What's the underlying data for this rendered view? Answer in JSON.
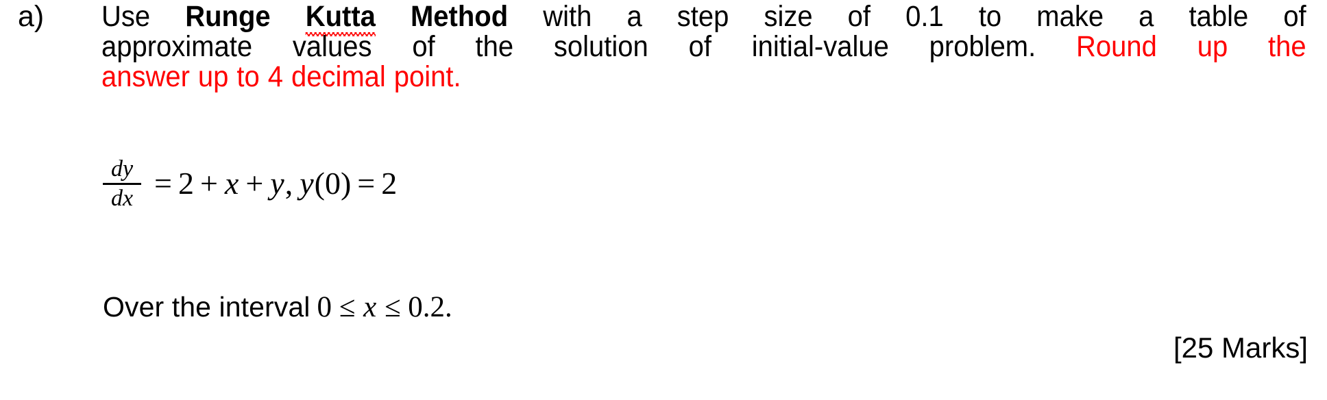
{
  "document": {
    "background_color": "#ffffff",
    "text_color": "#000000",
    "highlight_color": "#ff0000",
    "spellcheck_underline_color": "#ff0000"
  },
  "question": {
    "item_label": "a)",
    "marks": "[25 Marks]",
    "line1": {
      "words": [
        {
          "t": "Use",
          "style": "normal"
        },
        {
          "t": "Runge",
          "style": "bold"
        },
        {
          "t": "Kutta",
          "style": "bold-squiggle"
        },
        {
          "t": "Method",
          "style": "bold"
        },
        {
          "t": "with",
          "style": "normal"
        },
        {
          "t": "a",
          "style": "normal"
        },
        {
          "t": "step",
          "style": "normal"
        },
        {
          "t": "size",
          "style": "normal"
        },
        {
          "t": "of",
          "style": "normal"
        },
        {
          "t": "0.1",
          "style": "normal"
        },
        {
          "t": "to",
          "style": "normal"
        },
        {
          "t": "make",
          "style": "normal"
        },
        {
          "t": "a",
          "style": "normal"
        },
        {
          "t": "table",
          "style": "normal"
        },
        {
          "t": "of",
          "style": "normal"
        }
      ]
    },
    "line2": {
      "words": [
        {
          "t": "approximate",
          "style": "normal"
        },
        {
          "t": "values",
          "style": "normal"
        },
        {
          "t": "of",
          "style": "normal"
        },
        {
          "t": "the",
          "style": "normal"
        },
        {
          "t": "solution",
          "style": "normal"
        },
        {
          "t": "of",
          "style": "normal"
        },
        {
          "t": "initial-value",
          "style": "normal"
        },
        {
          "t": "problem.",
          "style": "normal"
        },
        {
          "t": "Round",
          "style": "red"
        },
        {
          "t": "up",
          "style": "red"
        },
        {
          "t": "the",
          "style": "red"
        }
      ]
    },
    "line3": {
      "words": [
        {
          "t": "answer",
          "style": "red"
        },
        {
          "t": "up",
          "style": "red"
        },
        {
          "t": "to",
          "style": "red"
        },
        {
          "t": "4",
          "style": "red"
        },
        {
          "t": "decimal",
          "style": "red"
        },
        {
          "t": "point.",
          "style": "red"
        }
      ]
    },
    "plain_text": "a) Use Runge Kutta Method with a step size of 0.1 to make a table of approximate values of the solution of initial-value problem. Round up the answer up to 4 decimal point.",
    "equation": {
      "fraction_numerator": "dy",
      "fraction_denominator": "dx",
      "equals": "=",
      "rhs_const": "2",
      "plus1": "+",
      "var_x": "x",
      "plus2": "+",
      "var_y": "y",
      "comma": ",",
      "initial_condition_fn": "y",
      "initial_condition_open": "(",
      "initial_condition_arg": "0",
      "initial_condition_close": ")",
      "equals2": "=",
      "initial_condition_value": "2",
      "plain_text": "dy/dx = 2 + x + y, y(0) = 2"
    },
    "interval": {
      "lead_text": "Over the interval",
      "math_text": "0 ≤ ",
      "math_var": "x",
      "math_tail": " ≤ 0.2.",
      "plain_text": "Over the interval 0 ≤ x ≤ 0.2."
    }
  }
}
